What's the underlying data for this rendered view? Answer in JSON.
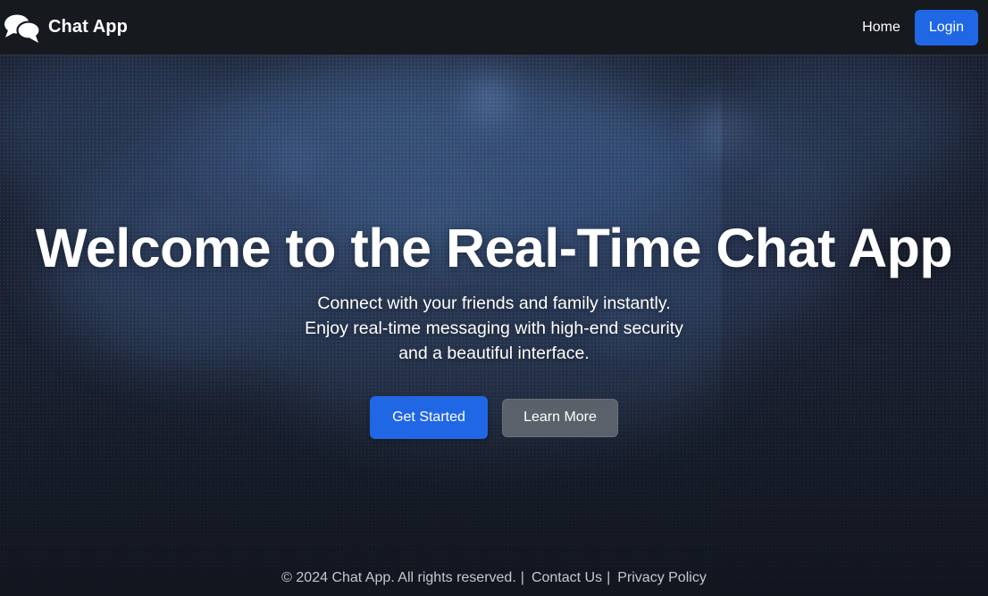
{
  "navbar": {
    "brand_name": "Chat App",
    "brand_icon": "chat-bubbles-icon",
    "home_label": "Home",
    "login_label": "Login"
  },
  "hero": {
    "title": "Welcome to the Real-Time Chat App",
    "subtitle_lines": [
      "Connect with your friends and family instantly.",
      "Enjoy real-time messaging with high-end security",
      "and a beautiful interface."
    ],
    "get_started_label": "Get Started",
    "learn_more_label": "Learn More"
  },
  "footer": {
    "copyright": "© 2024 Chat App. All rights reserved.",
    "separator": "|",
    "contact_label": "Contact Us",
    "privacy_label": "Privacy Policy"
  },
  "colors": {
    "navbar_bg": "#16191e",
    "hero_bg": "#1a2130",
    "primary": "#2067e6",
    "secondary": "#5b616a",
    "footer_text": "#c4c8cf"
  }
}
